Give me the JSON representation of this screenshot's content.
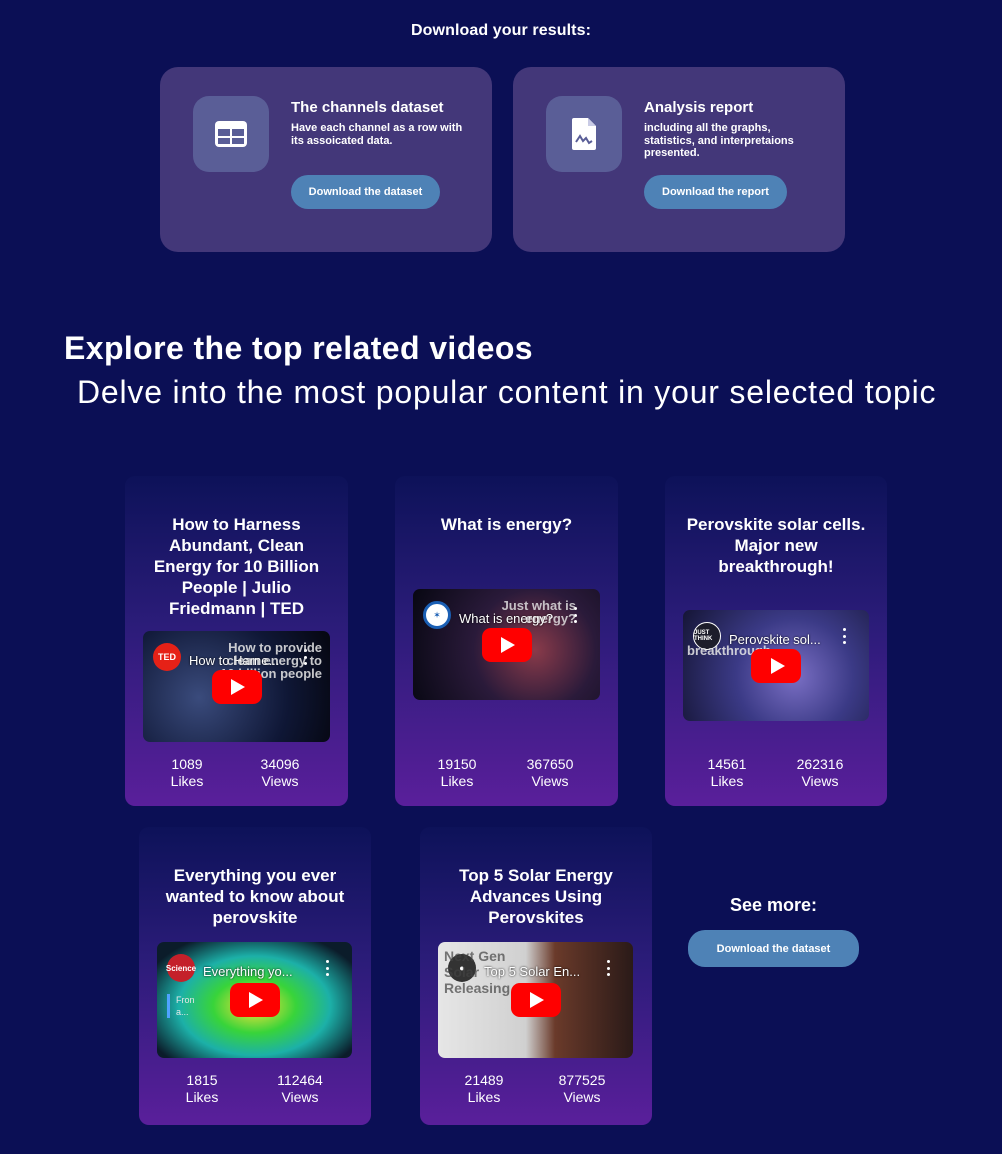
{
  "download": {
    "heading": "Download your results:",
    "cards": [
      {
        "icon": "table-icon",
        "title": "The channels dataset",
        "description": "Have each channel as a row with its assoicated data.",
        "button": "Download the dataset"
      },
      {
        "icon": "document-chart-icon",
        "title": "Analysis report",
        "description": "including all the graphs, statistics, and interpretaions presented.",
        "button": "Download the report"
      }
    ]
  },
  "section": {
    "title": "Explore the top related videos",
    "subtitle": "Delve into the most popular content in your selected topic"
  },
  "videos": [
    {
      "title": "How to Harness Abundant, Clean Energy for 10 Billion People | Julio Friedmann | TED",
      "embed_title": "How to Harne...",
      "overlay": "How to provide clean energy to 10 billion people",
      "channel_badge": "TED",
      "likes": "1089",
      "views": "34096"
    },
    {
      "title": "What is energy?",
      "embed_title": "What is energy?",
      "overlay": "Just what is energy?",
      "likes": "19150",
      "views": "367650"
    },
    {
      "title": "Perovskite solar cells. Major new breakthrough!",
      "embed_title": "Perovskite sol...",
      "overlay": "breakthrough",
      "channel_badge": "JUST THINK",
      "likes": "14561",
      "views": "262316"
    },
    {
      "title": "Everything you ever wanted to know about perovskite",
      "embed_title": "Everything yo...",
      "overlay": "Fron a...",
      "channel_badge": "Science",
      "likes": "1815",
      "views": "112464"
    },
    {
      "title": "Top 5 Solar Energy Advances Using Perovskites",
      "embed_title": "Top 5 Solar En...",
      "overlay": "Next Gen Solar Releasing 2",
      "likes": "21489",
      "views": "877525"
    }
  ],
  "stats_labels": {
    "likes": "Likes",
    "views": "Views"
  },
  "see_more": {
    "label": "See more:",
    "button": "Download the dataset"
  }
}
